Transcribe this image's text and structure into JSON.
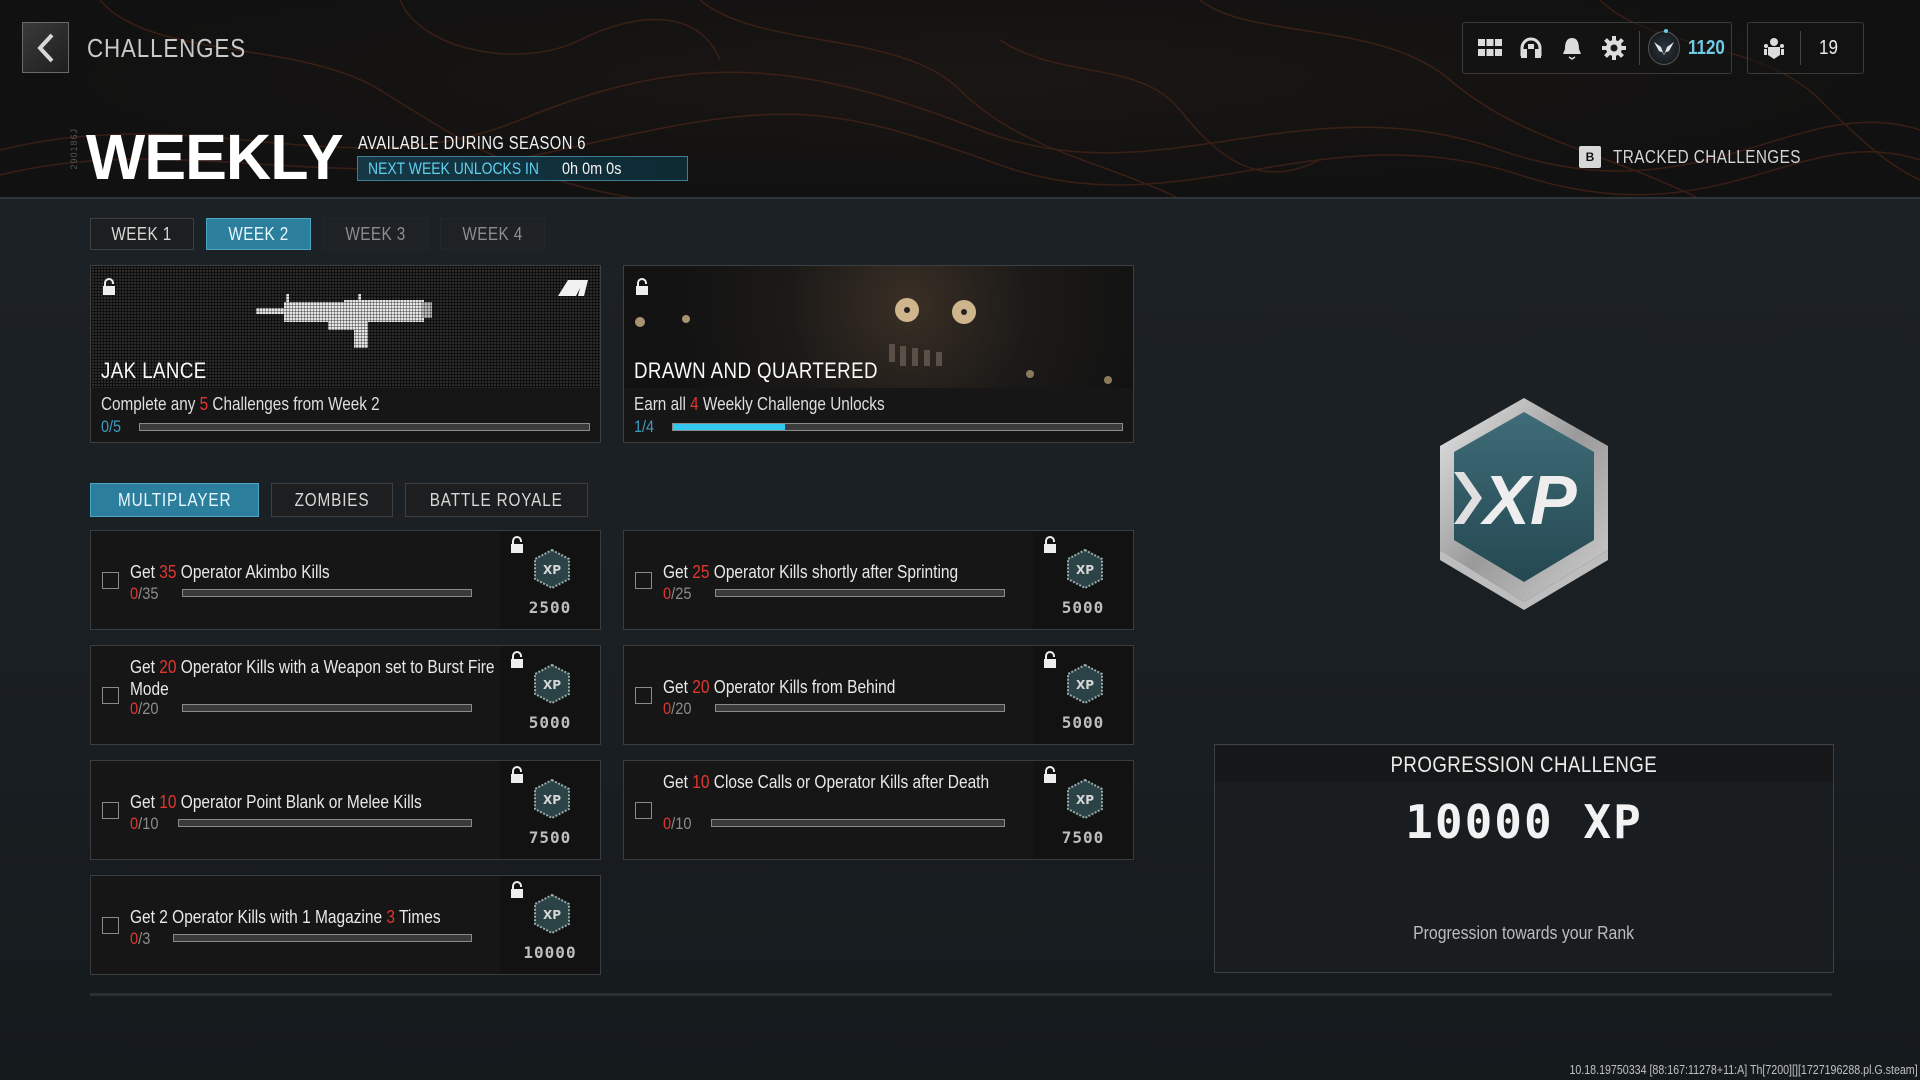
{
  "header": {
    "breadcrumb": "CHALLENGES",
    "title": "WEEKLY",
    "vertical_tag": "290186J",
    "season_text": "AVAILABLE DURING SEASON 6",
    "unlock_label": "NEXT WEEK UNLOCKS IN",
    "unlock_time": "0h 0m 0s",
    "hud": {
      "icons": [
        "grid-menu-icon",
        "headset-icon",
        "notification-bell-icon",
        "settings-gear-icon"
      ],
      "rank_value": "1120",
      "party_count": "19"
    },
    "tracked": {
      "key": "B",
      "label": "TRACKED CHALLENGES"
    }
  },
  "week_tabs": [
    {
      "label": "WEEK 1",
      "state": "normal"
    },
    {
      "label": "WEEK 2",
      "state": "active"
    },
    {
      "label": "WEEK 3",
      "state": "dim"
    },
    {
      "label": "WEEK 4",
      "state": "dim"
    }
  ],
  "unlock_cards": [
    {
      "title": "JAK LANCE",
      "desc_pre": "Complete any ",
      "desc_hl": "5",
      "desc_post": " Challenges from Week 2",
      "progress_text": "0/5",
      "progress": 0.0
    },
    {
      "title": "DRAWN AND QUARTERED",
      "desc_pre": "Earn all ",
      "desc_hl": "4",
      "desc_post": " Weekly Challenge Unlocks",
      "progress_text": "1/4",
      "progress": 0.25
    }
  ],
  "mode_tabs": [
    {
      "label": "MULTIPLAYER",
      "state": "active"
    },
    {
      "label": "ZOMBIES",
      "state": "normal"
    },
    {
      "label": "BATTLE ROYALE",
      "state": "normal"
    }
  ],
  "challenges": [
    {
      "pre": "Get ",
      "hl": "35",
      "post": " Operator Akimbo Kills",
      "cur": "0",
      "total": "/35",
      "xp": "2500",
      "progress": 0
    },
    {
      "pre": "Get ",
      "hl": "25",
      "post": " Operator Kills shortly after Sprinting",
      "cur": "0",
      "total": "/25",
      "xp": "5000",
      "progress": 0
    },
    {
      "pre": "Get ",
      "hl": "20",
      "post": " Operator Kills with a Weapon set to Burst Fire Mode",
      "cur": "0",
      "total": "/20",
      "xp": "5000",
      "progress": 0
    },
    {
      "pre": "Get ",
      "hl": "20",
      "post": " Operator Kills from Behind",
      "cur": "0",
      "total": "/20",
      "xp": "5000",
      "progress": 0
    },
    {
      "pre": "Get ",
      "hl": "10",
      "post": " Operator Point Blank or Melee Kills",
      "cur": "0",
      "total": "/10",
      "xp": "7500",
      "progress": 0
    },
    {
      "pre": "Get ",
      "hl": "10",
      "post": " Close Calls or Operator Kills after Death",
      "cur": "0",
      "total": "/10",
      "xp": "7500",
      "progress": 0
    },
    {
      "pre": "Get 2 Operator Kills with 1 Magazine ",
      "hl": "3",
      "post": " Times",
      "cur": "0",
      "total": "/3",
      "xp": "10000",
      "progress": 0
    }
  ],
  "progression": {
    "badge_text": "XP",
    "heading": "PROGRESSION CHALLENGE",
    "amount": "10000 XP",
    "subtitle": "Progression towards your Rank"
  },
  "build_info": "10.18.19750334 [88:167:11278+11:A] Th[7200][][1727196288.pl.G.steam]",
  "colors": {
    "accent": "#2c7f9c",
    "highlight": "#e0372e",
    "progress_fill": "#32c7ee",
    "rank_value": "#6ecbe8"
  }
}
